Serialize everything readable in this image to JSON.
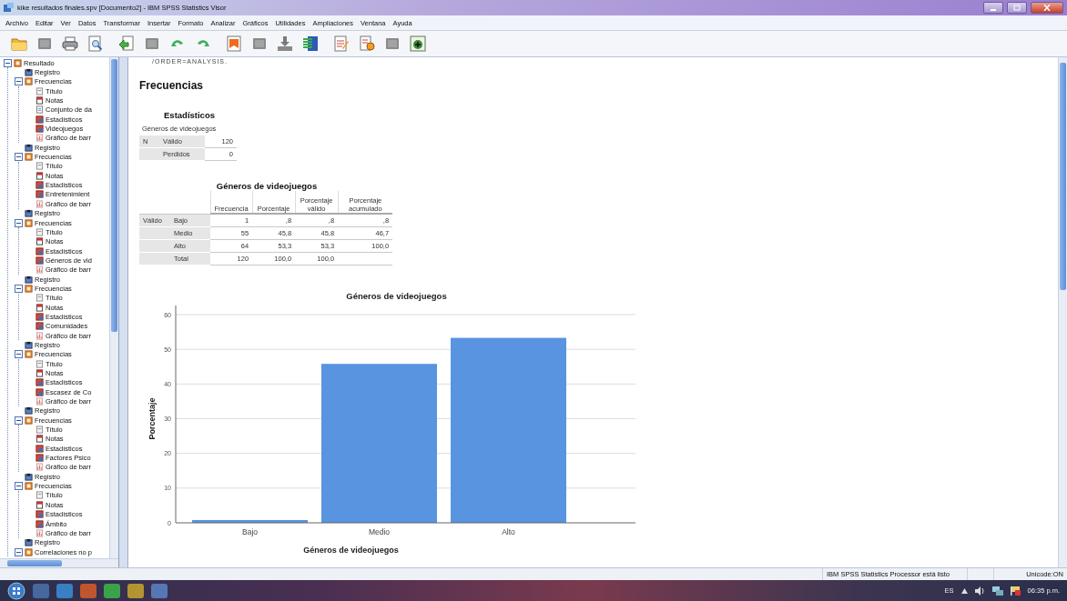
{
  "window": {
    "title": "kike resultados finales.spv [Documento2] - IBM SPSS Statistics Visor"
  },
  "menu": [
    "Archivo",
    "Editar",
    "Ver",
    "Datos",
    "Transformar",
    "Insertar",
    "Formato",
    "Analizar",
    "Gráficos",
    "Utilidades",
    "Ampliaciones",
    "Ventana",
    "Ayuda"
  ],
  "toolbar": [
    {
      "kind": "open",
      "disabled": false
    },
    {
      "kind": "save",
      "disabled": true
    },
    {
      "kind": "print",
      "disabled": false
    },
    {
      "kind": "preview",
      "disabled": false
    },
    {
      "kind": "export",
      "disabled": false
    },
    {
      "kind": "dialog",
      "disabled": true
    },
    {
      "kind": "undo",
      "disabled": false
    },
    {
      "kind": "redo",
      "disabled": false
    },
    {
      "kind": "bookmark",
      "disabled": false
    },
    {
      "kind": "case",
      "disabled": true
    },
    {
      "kind": "download",
      "disabled": false
    },
    {
      "kind": "variables",
      "disabled": false
    },
    {
      "kind": "edit",
      "disabled": false
    },
    {
      "kind": "script",
      "disabled": false
    },
    {
      "kind": "frame",
      "disabled": true
    },
    {
      "kind": "designate",
      "disabled": false
    }
  ],
  "outline": {
    "label": "Resultado",
    "kind": "procedure",
    "expanded": true,
    "children": [
      {
        "label": "Registro",
        "kind": "log"
      },
      {
        "label": "Frecuencias",
        "kind": "procedure",
        "expanded": true,
        "children": [
          {
            "label": "Título",
            "kind": "title"
          },
          {
            "label": "Notas",
            "kind": "notes"
          },
          {
            "label": "Conjunto de da",
            "kind": "dataset"
          },
          {
            "label": "Estadísticos",
            "kind": "table"
          },
          {
            "label": "Videojuegos",
            "kind": "table"
          },
          {
            "label": "Gráfico de barr",
            "kind": "chart"
          }
        ]
      },
      {
        "label": "Registro",
        "kind": "log"
      },
      {
        "label": "Frecuencias",
        "kind": "procedure",
        "expanded": true,
        "children": [
          {
            "label": "Título",
            "kind": "title"
          },
          {
            "label": "Notas",
            "kind": "notes"
          },
          {
            "label": "Estadísticos",
            "kind": "table"
          },
          {
            "label": "Entretenimient",
            "kind": "table"
          },
          {
            "label": "Gráfico de barr",
            "kind": "chart"
          }
        ]
      },
      {
        "label": "Registro",
        "kind": "log"
      },
      {
        "label": "Frecuencias",
        "kind": "procedure",
        "expanded": true,
        "children": [
          {
            "label": "Título",
            "kind": "title"
          },
          {
            "label": "Notas",
            "kind": "notes"
          },
          {
            "label": "Estadísticos",
            "kind": "table"
          },
          {
            "label": "Géneros de vid",
            "kind": "table"
          },
          {
            "label": "Gráfico de barr",
            "kind": "chart"
          }
        ]
      },
      {
        "label": "Registro",
        "kind": "log"
      },
      {
        "label": "Frecuencias",
        "kind": "procedure",
        "expanded": true,
        "children": [
          {
            "label": "Título",
            "kind": "title"
          },
          {
            "label": "Notas",
            "kind": "notes"
          },
          {
            "label": "Estadísticos",
            "kind": "table"
          },
          {
            "label": "Comunidades",
            "kind": "table"
          },
          {
            "label": "Gráfico de barr",
            "kind": "chart"
          }
        ]
      },
      {
        "label": "Registro",
        "kind": "log"
      },
      {
        "label": "Frecuencias",
        "kind": "procedure",
        "expanded": true,
        "children": [
          {
            "label": "Título",
            "kind": "title"
          },
          {
            "label": "Notas",
            "kind": "notes"
          },
          {
            "label": "Estadísticos",
            "kind": "table"
          },
          {
            "label": "Escasez de Co",
            "kind": "table"
          },
          {
            "label": "Gráfico de barr",
            "kind": "chart"
          }
        ]
      },
      {
        "label": "Registro",
        "kind": "log"
      },
      {
        "label": "Frecuencias",
        "kind": "procedure",
        "expanded": true,
        "children": [
          {
            "label": "Título",
            "kind": "title"
          },
          {
            "label": "Notas",
            "kind": "notes"
          },
          {
            "label": "Estadísticos",
            "kind": "table"
          },
          {
            "label": "Factores Psico",
            "kind": "table"
          },
          {
            "label": "Gráfico de barr",
            "kind": "chart"
          }
        ]
      },
      {
        "label": "Registro",
        "kind": "log"
      },
      {
        "label": "Frecuencias",
        "kind": "procedure",
        "expanded": true,
        "children": [
          {
            "label": "Título",
            "kind": "title"
          },
          {
            "label": "Notas",
            "kind": "notes"
          },
          {
            "label": "Estadísticos",
            "kind": "table"
          },
          {
            "label": "Ámbito",
            "kind": "table"
          },
          {
            "label": "Gráfico de barr",
            "kind": "chart"
          }
        ]
      },
      {
        "label": "Registro",
        "kind": "log"
      },
      {
        "label": "Correlaciones no p",
        "kind": "procedure",
        "expanded": true
      }
    ]
  },
  "output": {
    "syntax_tail": "/ORDER=ANALYSIS.",
    "heading": "Frecuencias",
    "statistics_table": {
      "title": "Estadísticos",
      "caption": "Géneros de videojuegos",
      "rows": [
        [
          "N",
          "Válido",
          "120"
        ],
        [
          "",
          "Perdidos",
          "0"
        ]
      ]
    },
    "frequency_table": {
      "title": "Géneros de videojuegos",
      "columns": [
        "Frecuencia",
        "Porcentaje",
        "Porcentaje válido",
        "Porcentaje acumulado"
      ],
      "rows": [
        {
          "group": "Válido",
          "label": "Bajo",
          "cells": [
            "1",
            ",8",
            ",8",
            ",8"
          ]
        },
        {
          "group": "",
          "label": "Medio",
          "cells": [
            "55",
            "45,8",
            "45,8",
            "46,7"
          ]
        },
        {
          "group": "",
          "label": "Alto",
          "cells": [
            "64",
            "53,3",
            "53,3",
            "100,0"
          ]
        },
        {
          "group": "",
          "label": "Total",
          "cells": [
            "120",
            "100,0",
            "100,0",
            ""
          ]
        }
      ]
    },
    "chart": {
      "chart_data": {
        "type": "bar",
        "title": "Géneros de videojuegos",
        "xlabel": "Géneros de videojuegos",
        "ylabel": "Porcentaje",
        "categories": [
          "Bajo",
          "Medio",
          "Alto"
        ],
        "values": [
          0.8,
          45.8,
          53.3
        ],
        "grid": true,
        "ylim": [
          0,
          60
        ],
        "yticks": [
          0,
          10,
          20,
          30,
          40,
          50,
          60
        ]
      }
    }
  },
  "status_bar": {
    "message": "IBM SPSS Statistics Processor está listo",
    "encoding": "Unicode:ON"
  },
  "taskbar": {
    "language": "ES",
    "clock": "06:35 p.m."
  }
}
